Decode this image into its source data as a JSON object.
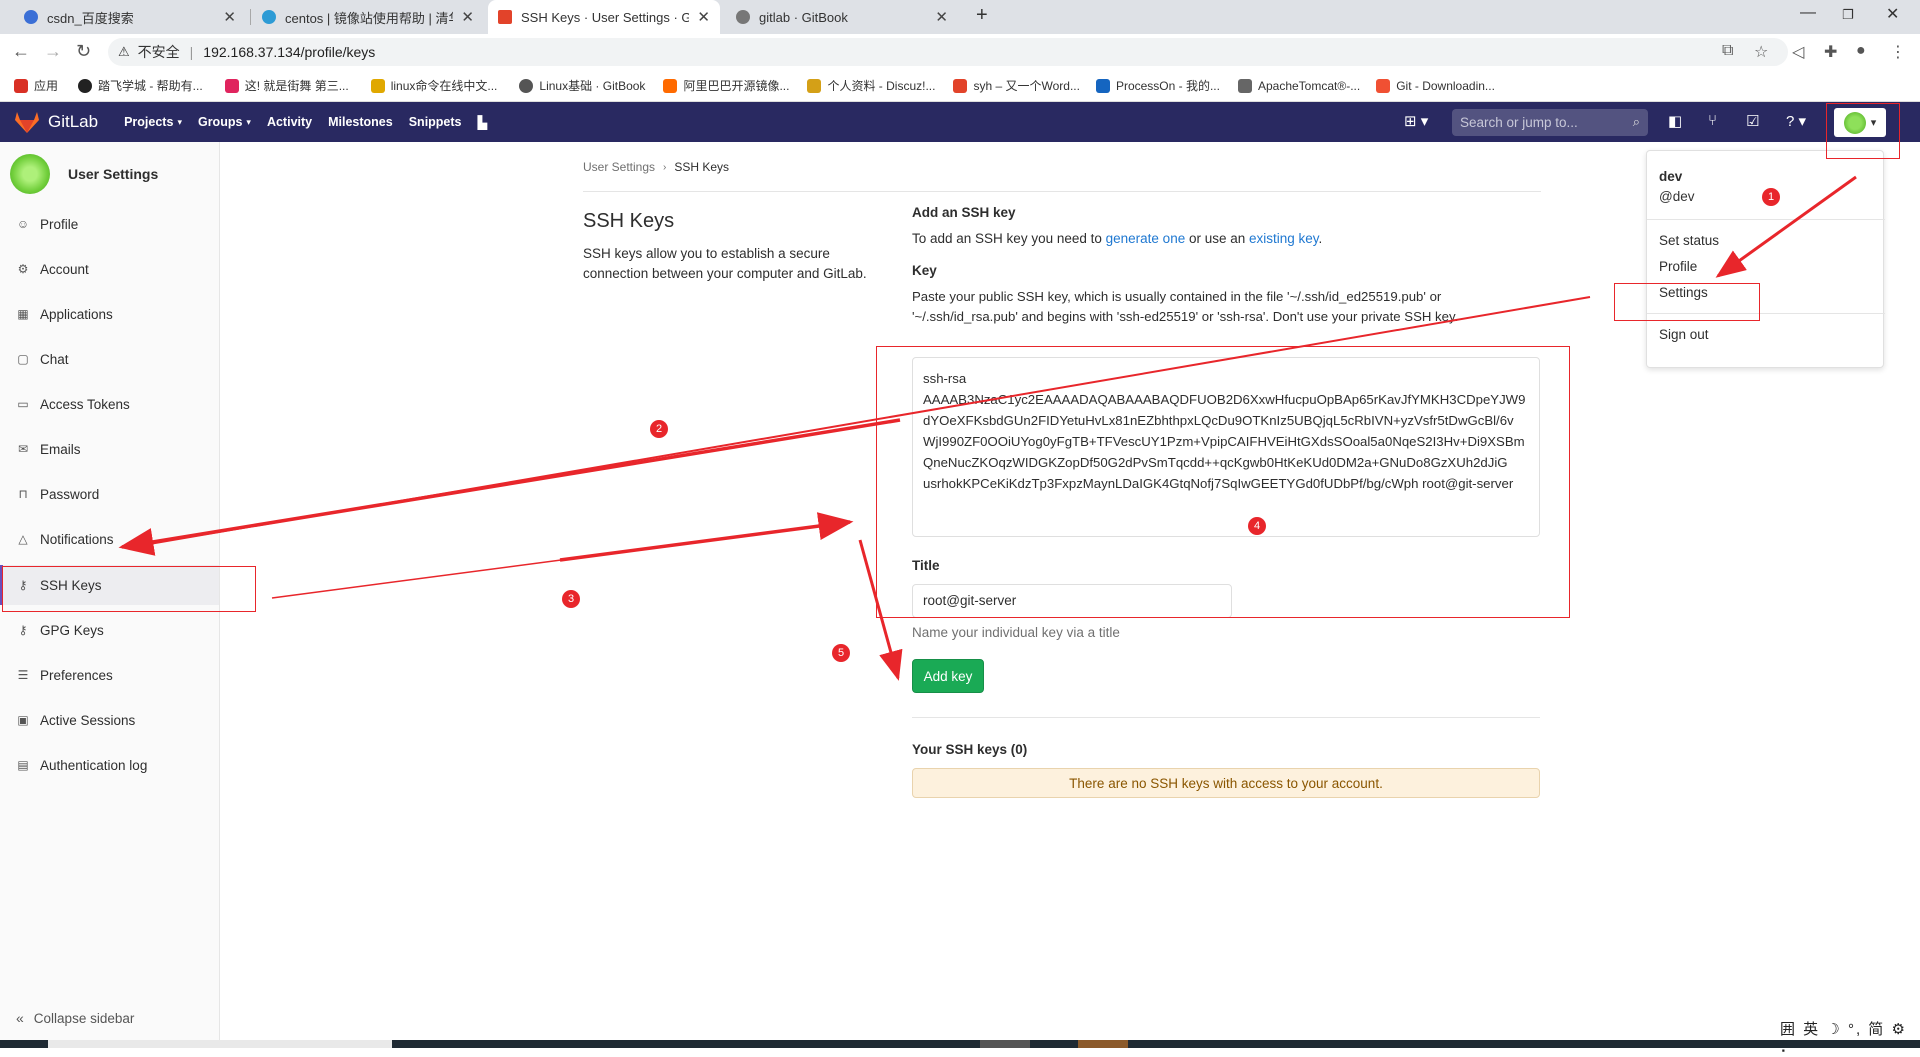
{
  "browser": {
    "tabs": [
      {
        "title": "csdn_百度搜索",
        "color": "#3b6fd6"
      },
      {
        "title": "centos | 镜像站使用帮助 | 清华大",
        "color": "#2d9bd5"
      },
      {
        "title": "SSH Keys · User Settings · GitL",
        "color": "#e2432a"
      },
      {
        "title": "gitlab · GitBook",
        "color": "#555555"
      }
    ],
    "insecure_label": "不安全",
    "url": "192.168.37.134/profile/keys",
    "bookmarks": [
      {
        "label": "应用",
        "color": "#d93025"
      },
      {
        "label": "踏飞学城 - 帮助有...",
        "color": "#222222"
      },
      {
        "label": "这! 就是街舞 第三...",
        "color": "#e0245e"
      },
      {
        "label": "linux命令在线中文...",
        "color": "#e0a800"
      },
      {
        "label": "Linux基础 · GitBook",
        "color": "#555555"
      },
      {
        "label": "阿里巴巴开源镜像...",
        "color": "#ff6a00"
      },
      {
        "label": "个人资料 - Discuz!...",
        "color": "#d4a017"
      },
      {
        "label": "syh – 又一个Word...",
        "color": "#e2432a"
      },
      {
        "label": "ProcessOn - 我的...",
        "color": "#1565c0"
      },
      {
        "label": "ApacheTomcat®-...",
        "color": "#666666"
      },
      {
        "label": "Git - Downloadin...",
        "color": "#f05033"
      }
    ]
  },
  "gitlab": {
    "brand": "GitLab",
    "nav": [
      {
        "label": "Projects",
        "dropdown": true
      },
      {
        "label": "Groups",
        "dropdown": true
      },
      {
        "label": "Activity",
        "dropdown": false
      },
      {
        "label": "Milestones",
        "dropdown": false
      },
      {
        "label": "Snippets",
        "dropdown": false
      }
    ],
    "search_placeholder": "Search or jump to...",
    "header_color": "#292961"
  },
  "sidebar": {
    "title": "User Settings",
    "items": [
      {
        "label": "Profile",
        "icon": "profile-icon",
        "glyph": "☺"
      },
      {
        "label": "Account",
        "icon": "account-icon",
        "glyph": "⚙"
      },
      {
        "label": "Applications",
        "icon": "applications-icon",
        "glyph": "▦"
      },
      {
        "label": "Chat",
        "icon": "chat-icon",
        "glyph": "▢"
      },
      {
        "label": "Access Tokens",
        "icon": "token-icon",
        "glyph": "▭"
      },
      {
        "label": "Emails",
        "icon": "email-icon",
        "glyph": "✉"
      },
      {
        "label": "Password",
        "icon": "lock-icon",
        "glyph": "🔒"
      },
      {
        "label": "Notifications",
        "icon": "bell-icon",
        "glyph": "△"
      },
      {
        "label": "SSH Keys",
        "icon": "key-icon",
        "glyph": "⚷"
      },
      {
        "label": "GPG Keys",
        "icon": "gpg-key-icon",
        "glyph": "⚷"
      },
      {
        "label": "Preferences",
        "icon": "preferences-icon",
        "glyph": "☰"
      },
      {
        "label": "Active Sessions",
        "icon": "sessions-icon",
        "glyph": "▣"
      },
      {
        "label": "Authentication log",
        "icon": "log-icon",
        "glyph": "▤"
      }
    ],
    "active": "SSH Keys",
    "collapse_label": "Collapse sidebar"
  },
  "breadcrumb": {
    "parent": "User Settings",
    "current": "SSH Keys"
  },
  "left_panel": {
    "title": "SSH Keys",
    "description": "SSH keys allow you to establish a secure connection between your computer and GitLab."
  },
  "form": {
    "add_heading": "Add an SSH key",
    "intro_prefix": "To add an SSH key you need to ",
    "intro_link1": "generate one",
    "intro_mid": " or use an ",
    "intro_link2": "existing key",
    "intro_suffix": ".",
    "key_label": "Key",
    "key_help": "Paste your public SSH key, which is usually contained in the file '~/.ssh/id_ed25519.pub' or '~/.ssh/id_rsa.pub' and begins with 'ssh-ed25519' or 'ssh-rsa'. Don't use your private SSH key.",
    "key_lines": [
      "ssh-rsa",
      "AAAAB3NzaC1yc2EAAAADAQABAAABAQDFUOB2D6XxwHfucpuOpBAp65rKavJfYMKH3CDpeYJW9",
      "dYOeXFKsbdGUn2FIDYetuHvLx81nEZbhthpxLQcDu9OTKnIz5UBQjqL5cRbIVN+yzVsfr5tDwGcBl/6v",
      "WjI990ZF0OOiUYog0yFgTB+TFVescUY1Pzm+VpipCAIFHVEiHtGXdsSOoal5a0NqeS2I3Hv+Di9XSBm",
      "QneNucZKOqzWIDGKZopDf50G2dPvSmTqcdd++qcKgwb0HtKeKUd0DM2a+GNuDo8GzXUh2dJiG",
      "usrhokKPCeKiKdzTp3FxpzMaynLDaIGK4GtqNofj7SqIwGEETYGd0fUDbPf/bg/cWph root@git-server"
    ],
    "title_label": "Title",
    "title_value": "root@git-server",
    "title_help": "Name your individual key via a title",
    "submit_label": "Add key",
    "your_keys_heading": "Your SSH keys (0)",
    "empty_message": "There are no SSH keys with access to your account."
  },
  "user_menu": {
    "name": "dev",
    "username": "@dev",
    "items": [
      "Set status",
      "Profile",
      "Settings",
      "Sign out"
    ]
  },
  "annotations": {
    "badges": [
      "1",
      "2",
      "3",
      "4",
      "5"
    ],
    "color": "#e8262b"
  },
  "ime": "囲 英 ☽ °, 简 ⚙ ⠇"
}
